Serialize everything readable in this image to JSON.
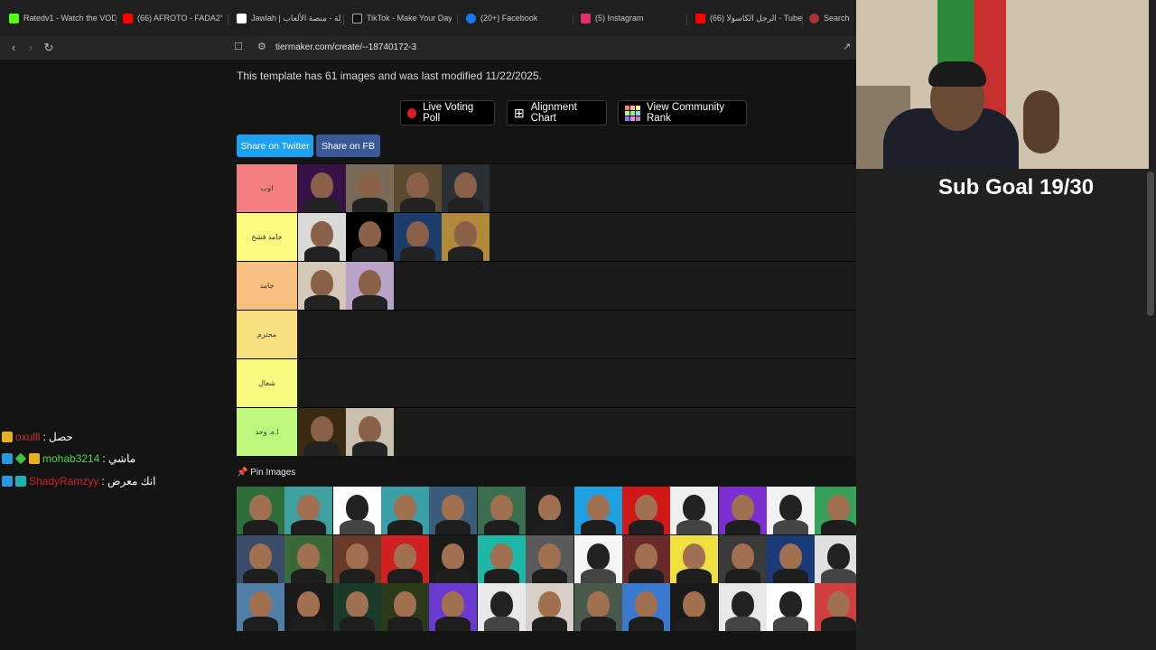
{
  "browser": {
    "tabs": [
      {
        "label": "Ratedv1 - Watch the VOD",
        "color": "#53fc18"
      },
      {
        "label": "(66) AFROTO - FADA2Y -",
        "color": "#ff0000"
      },
      {
        "label": "Jawlah | جولة - منصة الألعاب",
        "color": "#ffffff"
      },
      {
        "label": "TikTok - Make Your Day",
        "color": "#111111"
      },
      {
        "label": "(20+) Facebook",
        "color": "#1877f2"
      },
      {
        "label": "(5) Instagram",
        "color": "#e1306c"
      },
      {
        "label": "(66) الرجل الكاسولا - Tube",
        "color": "#ff0000"
      },
      {
        "label": "Search",
        "color": "#aa3333"
      }
    ],
    "url": "tiermaker.com/create/--18740172-3"
  },
  "page": {
    "info": "This template has 61 images and was last modified 11/22/2025.",
    "buttons": {
      "live_voting": "Live Voting Poll",
      "alignment": "Alignment Chart",
      "community": "View Community Rank"
    },
    "share_twitter": "Share on Twitter",
    "share_fb": "Share on FB",
    "pin_label": "Pin Images"
  },
  "tiers": [
    {
      "label": "اوب",
      "color": "#f47f7f",
      "items": [
        "#351248",
        "#7a6a58",
        "#5c4a33",
        "#2b2f36"
      ]
    },
    {
      "label": "جامد فشخ",
      "color": "#fbfb80",
      "items": [
        "#d9d9d9",
        "#000000",
        "#1a3d6b",
        "#b08a3a"
      ]
    },
    {
      "label": "جامد",
      "color": "#f7bf80",
      "items": [
        "#d4c8b8",
        "#b9a3c9"
      ]
    },
    {
      "label": "محترم",
      "color": "#f8df7f",
      "items": []
    },
    {
      "label": "شغال",
      "color": "#f8fa80",
      "items": []
    },
    {
      "label": "ا.ه. وحد",
      "color": "#bff87f",
      "items": [
        "#3a2a12",
        "#c9c0b0"
      ]
    }
  ],
  "pool_colors": [
    "#2e6e3a",
    "#3fa0a0",
    "#ffffff",
    "#3aa0a8",
    "#3b5c7a",
    "#3c6e52",
    "#1c1c1c",
    "#1fa0e0",
    "#d01818",
    "#f0f0f0",
    "#7b2fd0",
    "#f2f2f2",
    "#37a05a",
    "#e0463a",
    "#3a4c6a",
    "#3a6a3a",
    "#6a3a2a",
    "#d02020",
    "#1a1a1a",
    "#1fb8a8",
    "#5a5a5a",
    "#f5f5f5",
    "#6a2a2a",
    "#f0e040",
    "#3a3a3a",
    "#1a3a7a",
    "#e0e0e0",
    "#f8a820",
    "#5080a8",
    "#1a1a1a",
    "#1a3a2a",
    "#2a3a1a",
    "#6a3ad0",
    "#e8e8e8",
    "#d8d0c8",
    "#4a5a4a",
    "#3a7ad0",
    "#1a1a1a",
    "#e8e8e8",
    "#ffffff",
    "#d04040",
    "#2a2a2a"
  ],
  "stream": {
    "sub_goal": "Sub Goal 19/30",
    "chat": [
      {
        "user": "oxulll",
        "msg": ": حصل",
        "color": "#d03030"
      },
      {
        "user": "mohab3214",
        "msg": ": ماشي",
        "color": "#4bd640"
      },
      {
        "user": "ShadyRamzyy",
        "msg": ": انك معرض",
        "color": "#d02030"
      }
    ]
  }
}
